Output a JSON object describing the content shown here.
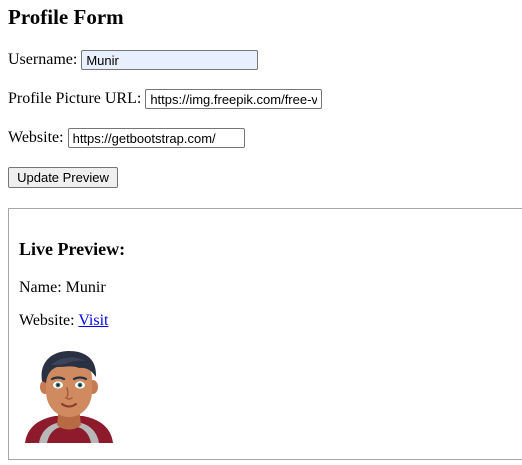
{
  "page": {
    "title": "Profile Form"
  },
  "form": {
    "username": {
      "label": "Username:",
      "value": "Munir"
    },
    "picture_url": {
      "label": "Profile Picture URL:",
      "value": "https://img.freepik.com/free-v"
    },
    "website": {
      "label": "Website:",
      "value": "https://getbootstrap.com/"
    },
    "update_button": "Update Preview"
  },
  "preview": {
    "heading": "Live Preview:",
    "name_label": "Name:",
    "name_value": "Munir",
    "website_label": "Website:",
    "website_link": "Visit",
    "avatar_icon": "cartoon-avatar-icon"
  },
  "colors": {
    "focused_input_bg": "#e8f0fe",
    "link": "#0000ee",
    "button_bg": "#efefef"
  }
}
